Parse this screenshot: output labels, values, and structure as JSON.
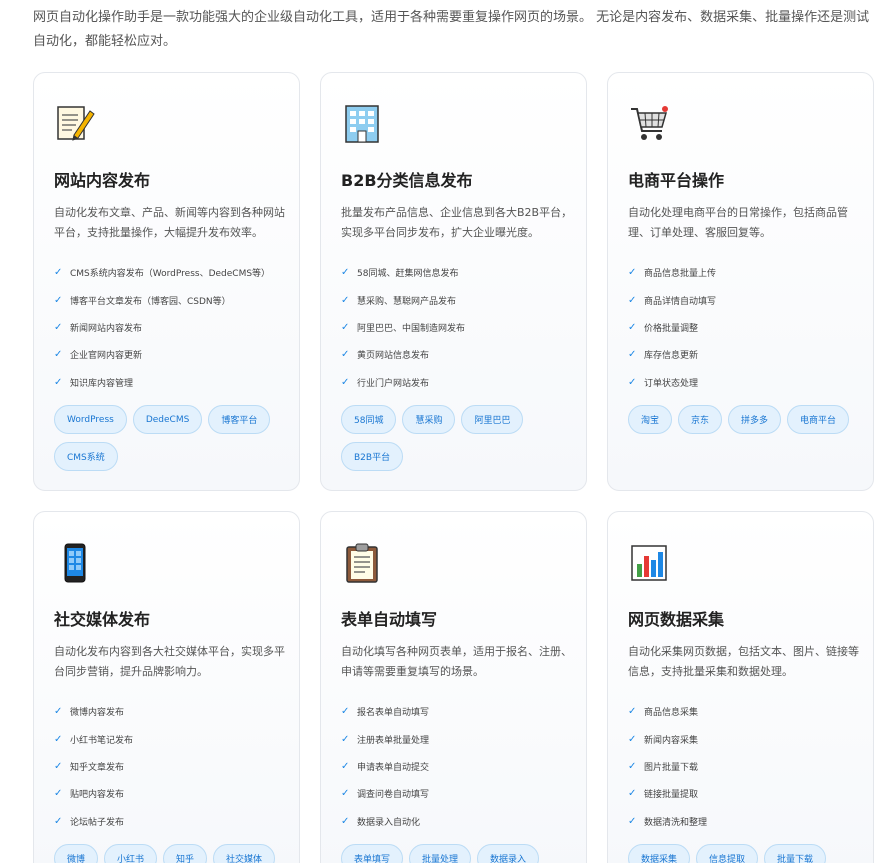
{
  "intro": "网页自动化操作助手是一款功能强大的企业级自动化工具，适用于各种需要重复操作网页的场景。 无论是内容发布、数据采集、批量操作还是测试自动化，都能轻松应对。",
  "cards": [
    {
      "icon": "memo-icon",
      "title": "网站内容发布",
      "desc": "自动化发布文章、产品、新闻等内容到各种网站平台，支持批量操作，大幅提升发布效率。",
      "features": [
        "CMS系统内容发布（WordPress、DedeCMS等）",
        "博客平台文章发布（博客园、CSDN等）",
        "新闻网站内容发布",
        "企业官网内容更新",
        "知识库内容管理"
      ],
      "tags": [
        "WordPress",
        "DedeCMS",
        "博客平台",
        "CMS系统"
      ]
    },
    {
      "icon": "office-building-icon",
      "title": "B2B分类信息发布",
      "desc": "批量发布产品信息、企业信息到各大B2B平台，实现多平台同步发布，扩大企业曝光度。",
      "features": [
        "58同城、赶集网信息发布",
        "慧采购、慧聪网产品发布",
        "阿里巴巴、中国制造网发布",
        "黄页网站信息发布",
        "行业门户网站发布"
      ],
      "tags": [
        "58同城",
        "慧采购",
        "阿里巴巴",
        "B2B平台"
      ]
    },
    {
      "icon": "shopping-cart-icon",
      "title": "电商平台操作",
      "desc": "自动化处理电商平台的日常操作，包括商品管理、订单处理、客服回复等。",
      "features": [
        "商品信息批量上传",
        "商品详情自动填写",
        "价格批量调整",
        "库存信息更新",
        "订单状态处理"
      ],
      "tags": [
        "淘宝",
        "京东",
        "拼多多",
        "电商平台"
      ]
    },
    {
      "icon": "mobile-phone-icon",
      "title": "社交媒体发布",
      "desc": "自动化发布内容到各大社交媒体平台，实现多平台同步营销，提升品牌影响力。",
      "features": [
        "微博内容发布",
        "小红书笔记发布",
        "知乎文章发布",
        "贴吧内容发布",
        "论坛帖子发布"
      ],
      "tags": [
        "微博",
        "小红书",
        "知乎",
        "社交媒体"
      ]
    },
    {
      "icon": "clipboard-icon",
      "title": "表单自动填写",
      "desc": "自动化填写各种网页表单，适用于报名、注册、申请等需要重复填写的场景。",
      "features": [
        "报名表单自动填写",
        "注册表单批量处理",
        "申请表单自动提交",
        "调查问卷自动填写",
        "数据录入自动化"
      ],
      "tags": [
        "表单填写",
        "批量处理",
        "数据录入"
      ]
    },
    {
      "icon": "bar-chart-icon",
      "title": "网页数据采集",
      "desc": "自动化采集网页数据，包括文本、图片、链接等信息，支持批量采集和数据处理。",
      "features": [
        "商品信息采集",
        "新闻内容采集",
        "图片批量下载",
        "链接批量提取",
        "数据清洗和整理"
      ],
      "tags": [
        "数据采集",
        "信息提取",
        "批量下载"
      ]
    }
  ],
  "check_glyph": "✓",
  "colors": {
    "accent": "#1e88e5",
    "tag_bg": "#e3f1fd",
    "tag_border": "#bcdcf5",
    "tag_text": "#1976d2"
  }
}
